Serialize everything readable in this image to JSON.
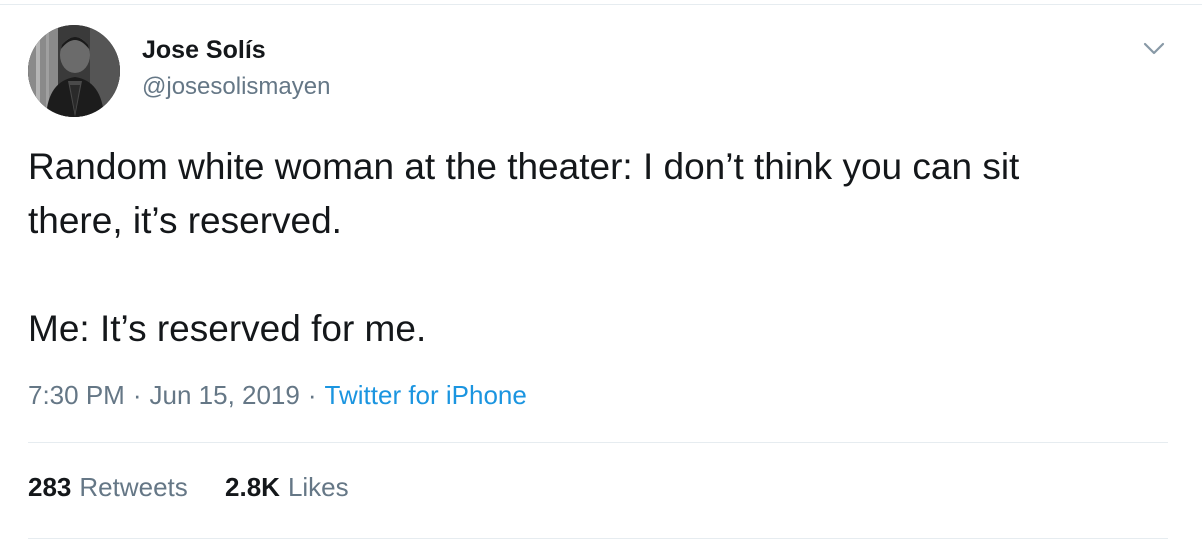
{
  "user": {
    "display_name": "Jose Solís",
    "handle": "@josesolismayen",
    "avatar_icon": "profile-photo"
  },
  "tweet": {
    "lines": [
      "Random white woman at the theater: I don’t think you can sit",
      "there, it’s reserved.",
      "Me: It’s reserved for me."
    ]
  },
  "meta": {
    "time": "7:30 PM",
    "separator": "·",
    "date": "Jun 15, 2019",
    "source": "Twitter for iPhone"
  },
  "stats": {
    "retweets_count": "283",
    "retweets_label": "Retweets",
    "likes_count": "2.8K",
    "likes_label": "Likes"
  },
  "colors": {
    "text": "#14171a",
    "secondary": "#657786",
    "link": "#1b95e0",
    "border": "#e6ecf0"
  },
  "icons": {
    "caret": "chevron-down-icon"
  }
}
